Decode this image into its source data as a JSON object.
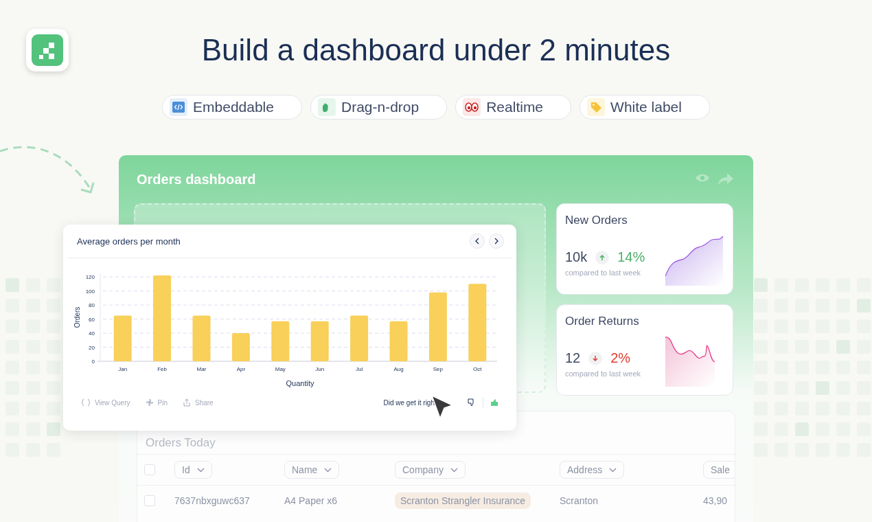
{
  "headline": "Build a dashboard under 2 minutes",
  "features": [
    {
      "label": "Embeddable"
    },
    {
      "label": "Drag-n-drop"
    },
    {
      "label": "Realtime"
    },
    {
      "label": "White label"
    }
  ],
  "dashboard": {
    "title": "Orders dashboard",
    "chart_card": {
      "title": "Average orders per month",
      "chart_data": {
        "type": "bar",
        "xlabel": "Quantity",
        "ylabel": "Orders",
        "categories": [
          "Jan",
          "Feb",
          "Mar",
          "Apr",
          "May",
          "Jun",
          "Jul",
          "Aug",
          "Sep",
          "Oct"
        ],
        "series": [
          {
            "color": "#f8d05a",
            "values": [
              65,
              122,
              65,
              40,
              57,
              57,
              65,
              57,
              98,
              110
            ]
          }
        ],
        "grid": true,
        "ylim": [
          0,
          125
        ],
        "yticks": [
          0,
          20,
          40,
          60,
          80,
          100,
          120
        ]
      },
      "actions": [
        "View Query",
        "Pin",
        "Share"
      ],
      "feedback": "Did we get it righ"
    },
    "stats": [
      {
        "title": "New Orders",
        "value": "10k",
        "kind": "up",
        "change": "14%",
        "note": "compared to last week"
      },
      {
        "title": "Order Returns",
        "value": "12",
        "kind": "down",
        "change": "2%",
        "note": "compared to last week"
      }
    ],
    "table": {
      "title": "Orders Today",
      "header_checked": false,
      "columns": [
        "Id",
        "Name",
        "Company",
        "Address",
        "Sale"
      ],
      "rows": [
        {
          "checked": false,
          "cells": [
            "7637nbxguwc637",
            "A4 Paper x6",
            "Scranton Strangler Insurance",
            "Scranton",
            "43,90"
          ]
        }
      ]
    }
  }
}
